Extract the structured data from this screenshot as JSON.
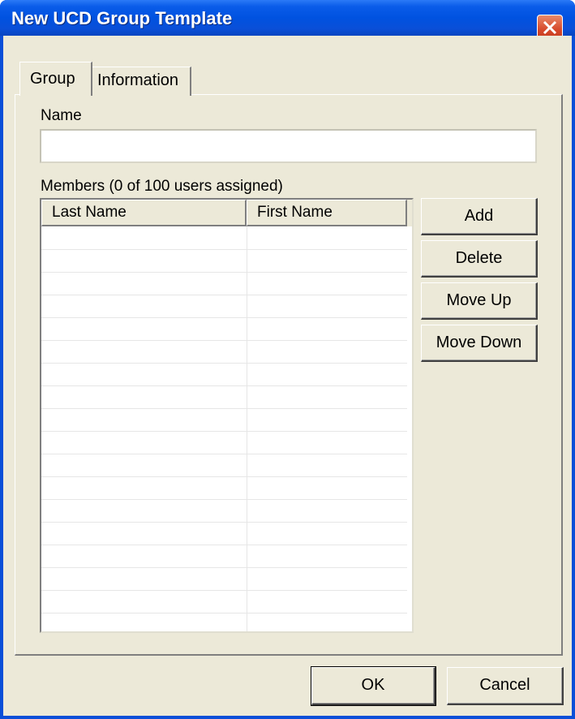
{
  "window": {
    "title": "New UCD Group Template"
  },
  "tabs": [
    {
      "label": "Group"
    },
    {
      "label": "Information"
    }
  ],
  "group": {
    "name_label": "Name",
    "name_value": "",
    "members_label": "Members (0 of 100 users assigned)",
    "columns": [
      "Last Name",
      "First Name"
    ],
    "rows": []
  },
  "side_buttons": {
    "add": "Add",
    "delete": "Delete",
    "move_up": "Move Up",
    "move_down": "Move Down"
  },
  "footer": {
    "ok": "OK",
    "cancel": "Cancel"
  },
  "colors": {
    "titlebar": "#0052e0",
    "face": "#ece9d8",
    "close": "#d6482a"
  }
}
